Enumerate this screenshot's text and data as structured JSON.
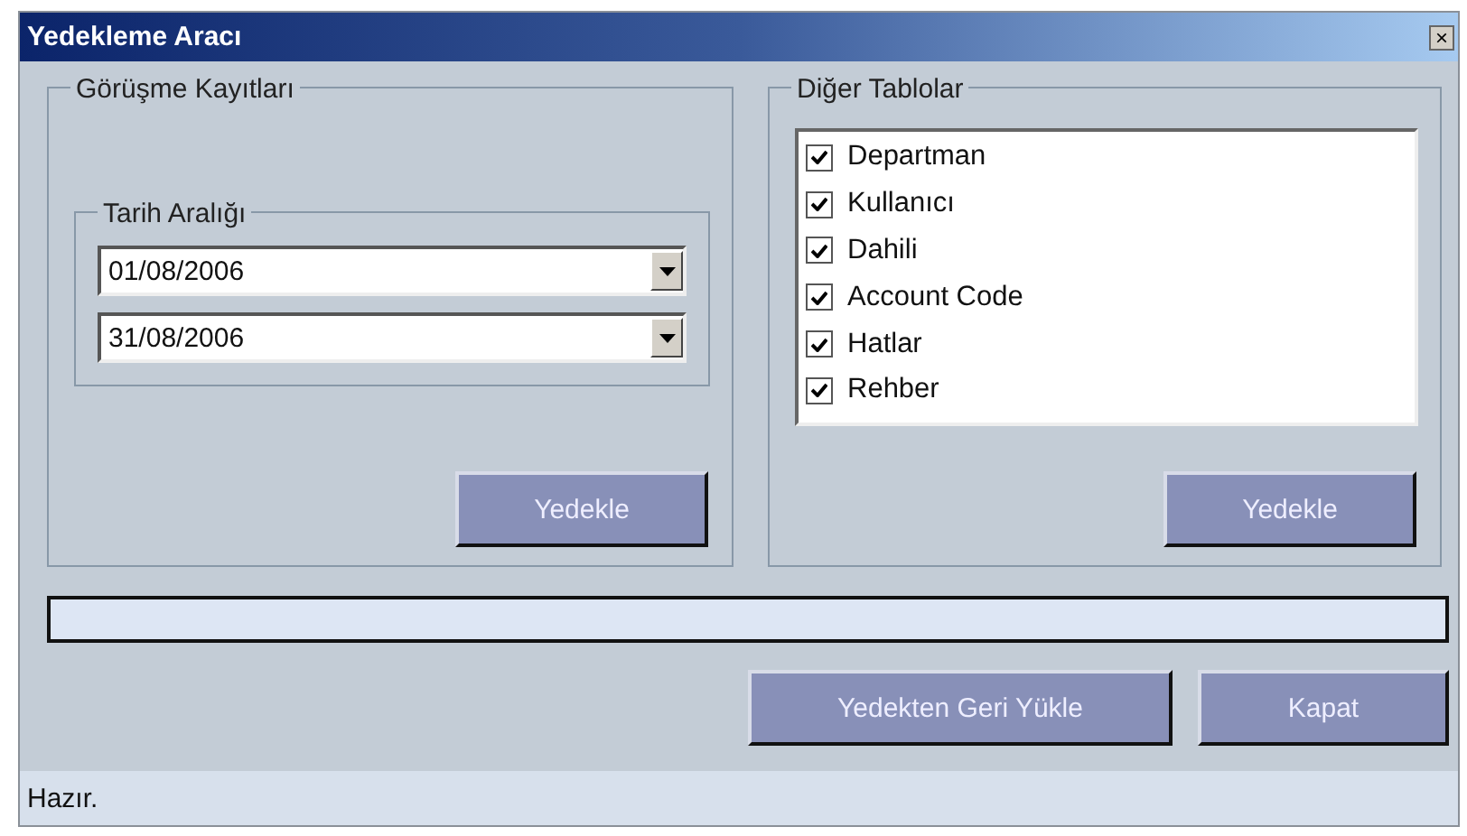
{
  "window": {
    "title": "Yedekleme Aracı",
    "close": "×"
  },
  "left_group": {
    "title": "Görüşme Kayıtları",
    "date_range": {
      "title": "Tarih Aralığı",
      "dates": [
        "01/08/2006",
        "31/08/2006"
      ]
    },
    "button": "Yedekle"
  },
  "right_group": {
    "title": "Diğer Tablolar",
    "items": [
      {
        "label": "Departman",
        "checked": true
      },
      {
        "label": "Kullanıcı",
        "checked": true
      },
      {
        "label": "Dahili",
        "checked": true
      },
      {
        "label": "Account Code",
        "checked": true
      },
      {
        "label": "Hatlar",
        "checked": true
      },
      {
        "label": "Rehber",
        "checked": true
      }
    ],
    "button": "Yedekle"
  },
  "progress": {
    "level": 0
  },
  "buttons": [
    "Yedekten Geri Yükle",
    "Kapat"
  ],
  "status_bar": "Hazır."
}
